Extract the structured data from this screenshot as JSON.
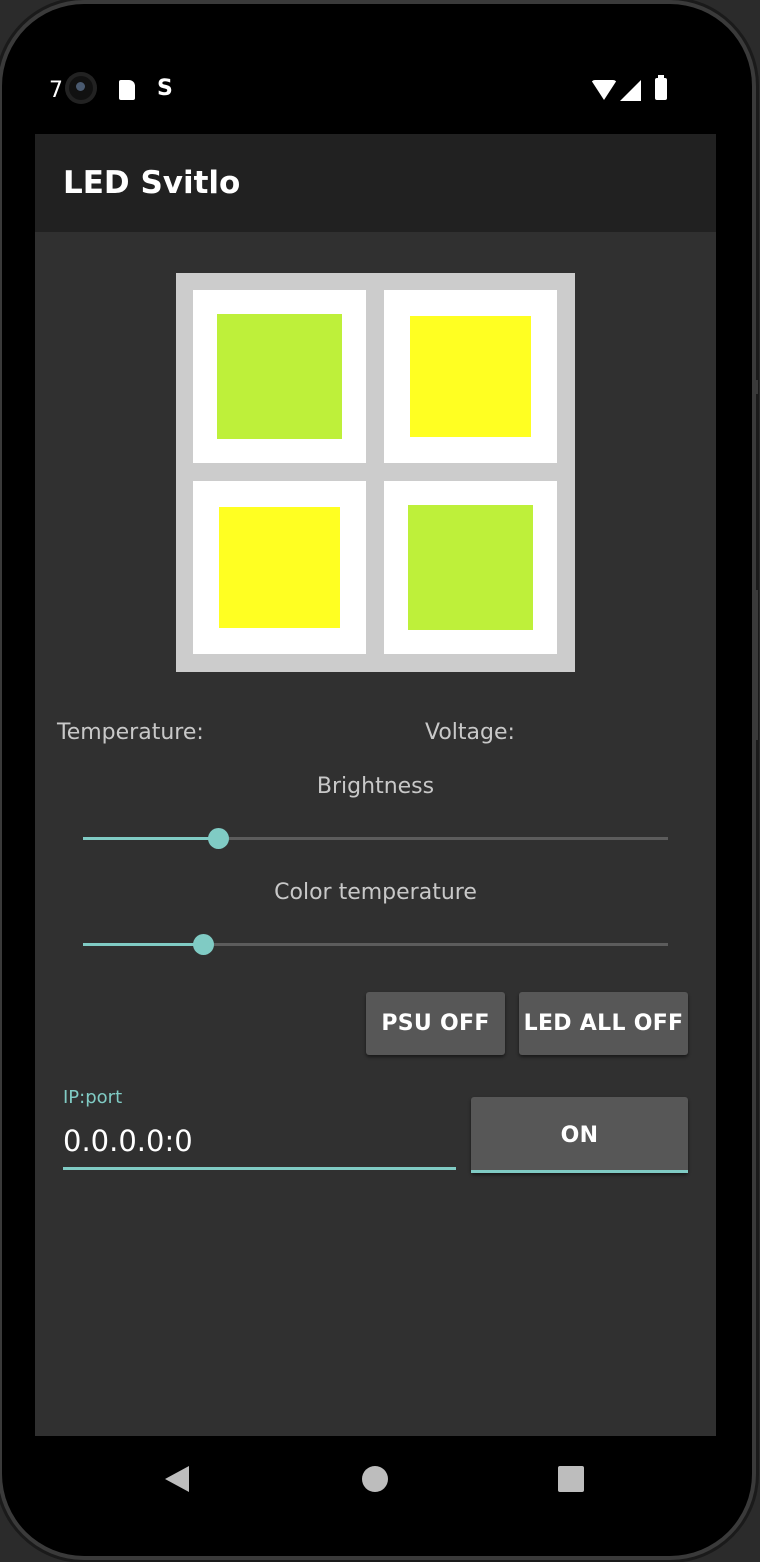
{
  "status_bar": {
    "time": "7",
    "notification_icons": [
      "sd-card-icon",
      "s-notification-icon"
    ],
    "system_icons": [
      "wifi-icon",
      "cellular-icon",
      "battery-icon"
    ]
  },
  "app": {
    "title": "LED Svitlo"
  },
  "led_panel": {
    "cells": [
      {
        "name": "led-top-left",
        "color": "#bef03a"
      },
      {
        "name": "led-top-right",
        "color": "#ffff22"
      },
      {
        "name": "led-bottom-left",
        "color": "#ffff22"
      },
      {
        "name": "led-bottom-right",
        "color": "#bef03a"
      }
    ],
    "frame_color": "#cccccc"
  },
  "readouts": {
    "temperature_label": "Temperature:",
    "voltage_label": "Voltage:"
  },
  "brightness": {
    "label": "Brightness",
    "value_fraction": 0.23
  },
  "color_temperature": {
    "label": "Color temperature",
    "value_fraction": 0.205
  },
  "buttons": {
    "psu_off": "PSU OFF",
    "led_all_off": "LED ALL OFF",
    "on": "ON"
  },
  "ip_field": {
    "label": "IP:port",
    "value": "0.0.0.0:0"
  },
  "colors": {
    "accent": "#80cbc4",
    "background": "#303030",
    "appbar": "#212121",
    "button": "#575757"
  },
  "nav_bar": {
    "icons": [
      "back-icon",
      "home-icon",
      "recents-icon"
    ]
  }
}
